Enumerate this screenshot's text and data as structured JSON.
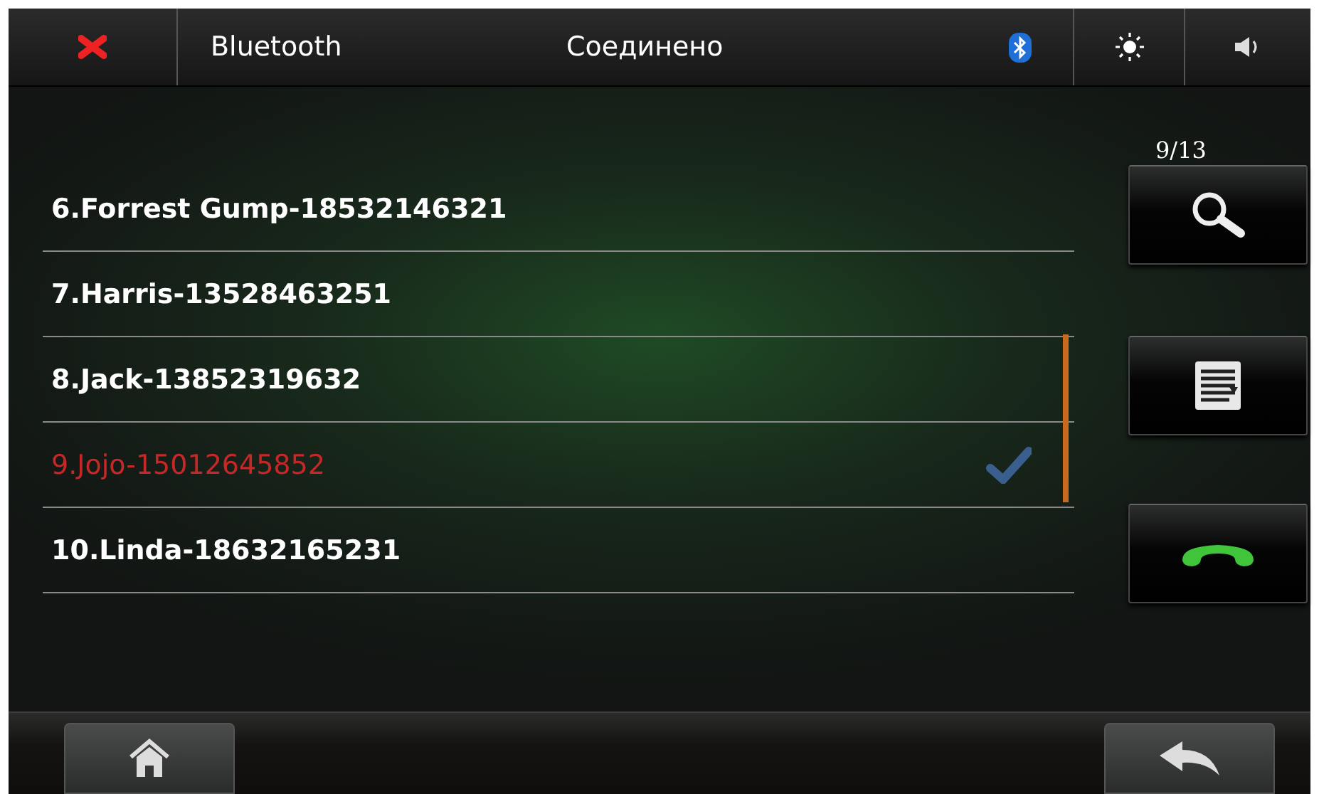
{
  "header": {
    "title": "Bluetooth",
    "status": "Соединено"
  },
  "contacts": [
    {
      "label": "6.Forrest Gump-18532146321",
      "selected": false
    },
    {
      "label": "7.Harris-13528463251",
      "selected": false
    },
    {
      "label": "8.Jack-13852319632",
      "selected": false
    },
    {
      "label": "9.Jojo-15012645852",
      "selected": true
    },
    {
      "label": "10.Linda-18632165231",
      "selected": false
    }
  ],
  "page_counter": "9/13"
}
